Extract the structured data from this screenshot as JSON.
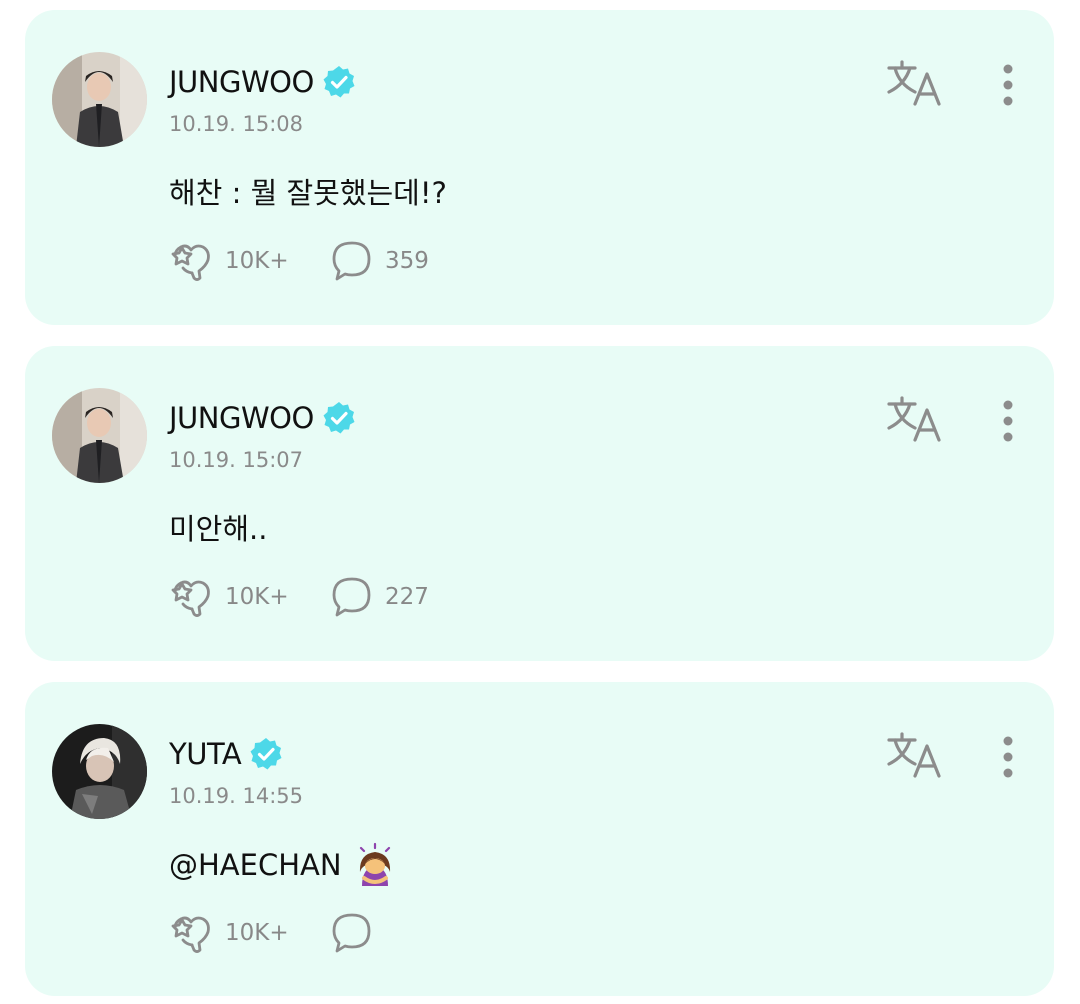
{
  "colors": {
    "card_background": "#e8fcf6",
    "verified_badge": "#4dd8e8",
    "username_text": "#111111",
    "meta_text": "#8a8a8a",
    "icon_gray": "#8c8c8c"
  },
  "icons": {
    "verified": "verified-badge-icon",
    "translate": "translate-icon",
    "more": "more-vertical-icon",
    "like": "like-heart-icon",
    "comment": "comment-bubble-icon"
  },
  "posts": [
    {
      "username": "JUNGWOO",
      "timestamp": "10.19. 15:08",
      "text": "해찬 : 뭘 잘못했는데!?",
      "likes": "10K+",
      "comments": "359"
    },
    {
      "username": "JUNGWOO",
      "timestamp": "10.19. 15:07",
      "text": "미안해..",
      "likes": "10K+",
      "comments": "227"
    },
    {
      "username": "YUTA",
      "timestamp": "10.19. 14:55",
      "text": "@HAECHAN",
      "emoji": "🙇‍♀️",
      "likes": "10K+",
      "comments": ""
    }
  ]
}
